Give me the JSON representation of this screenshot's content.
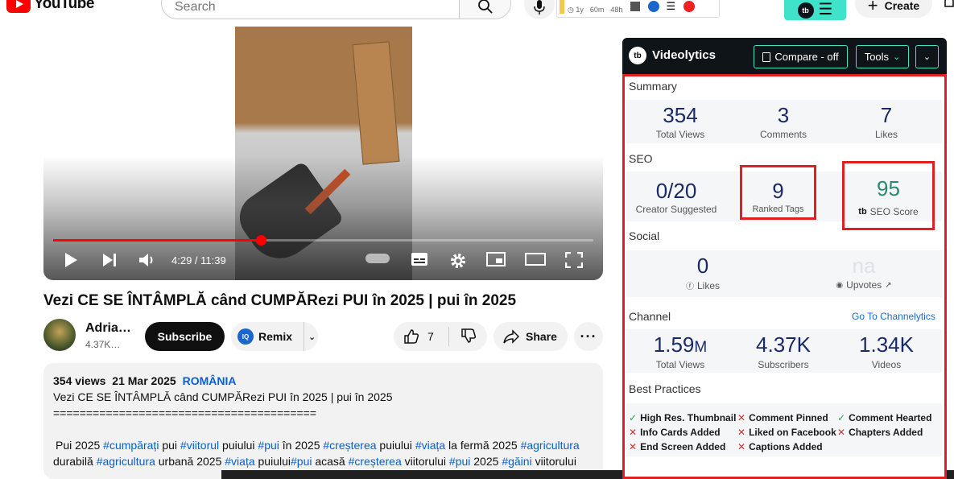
{
  "header": {
    "logo_text": "YouTube",
    "search_placeholder": "Search",
    "ext_stats": [
      "1y",
      "60m",
      "48h"
    ],
    "create_label": "Create"
  },
  "player": {
    "time": "4:29 / 11:39",
    "progress": 0.385
  },
  "video": {
    "title": "Vezi CE SE ÎNTÂMPLĂ când CUMPĂRezi PUI în 2025 | pui în 2025",
    "channel_name": "Adria…",
    "channel_subs": "4.37K…",
    "subscribe_label": "Subscribe",
    "remix_label": "Remix",
    "like_count": "7",
    "share_label": "Share"
  },
  "description": {
    "views": "354 views",
    "date": "21 Mar 2025",
    "location": "ROMÂNIA",
    "line1": "Vezi CE SE ÎNTÂMPLĂ când CUMPĂRezi PUI în 2025 | pui în 2025",
    "line2": "========================================",
    "tags_line": [
      {
        "t": "Pui 2025 ",
        "link": false
      },
      {
        "t": "#cumpărați",
        "link": true
      },
      {
        "t": " pui ",
        "link": false
      },
      {
        "t": "#viitorul",
        "link": true
      },
      {
        "t": " puiului ",
        "link": false
      },
      {
        "t": "#pui",
        "link": true
      },
      {
        "t": " în 2025 ",
        "link": false
      },
      {
        "t": "#creșterea",
        "link": true
      },
      {
        "t": " puiului ",
        "link": false
      },
      {
        "t": "#viața",
        "link": true
      },
      {
        "t": " la fermă 2025 ",
        "link": false
      },
      {
        "t": "#agricultura",
        "link": true
      }
    ],
    "tags_line2": [
      {
        "t": "durabilă ",
        "link": false
      },
      {
        "t": "#agricultura",
        "link": true
      },
      {
        "t": " urbană 2025 ",
        "link": false
      },
      {
        "t": "#viața",
        "link": true
      },
      {
        "t": " puiului",
        "link": false
      },
      {
        "t": "#pui",
        "link": true
      },
      {
        "t": " acasă ",
        "link": false
      },
      {
        "t": "#creșterea",
        "link": true
      },
      {
        "t": " viitorului ",
        "link": false
      },
      {
        "t": "#pui",
        "link": true
      },
      {
        "t": " 2025 ",
        "link": false
      },
      {
        "t": "#găini",
        "link": true
      },
      {
        "t": " viitorului",
        "link": false
      }
    ]
  },
  "videolytics": {
    "brand": "Videolytics",
    "compare_label": "Compare - off",
    "tools_label": "Tools",
    "summary_label": "Summary",
    "summary": [
      {
        "value": "354",
        "label": "Total Views"
      },
      {
        "value": "3",
        "label": "Comments"
      },
      {
        "value": "7",
        "label": "Likes"
      }
    ],
    "seo_label": "SEO",
    "seo": {
      "creator_value": "0/20",
      "creator_label": "Creator Suggested",
      "ranked_value": "9",
      "ranked_label": "Ranked Tags",
      "score_value": "95",
      "score_label": "SEO Score"
    },
    "social_label": "Social",
    "social": {
      "likes_value": "0",
      "likes_label": "Likes",
      "upvotes_value": "na",
      "upvotes_label": "Upvotes"
    },
    "channel_label": "Channel",
    "channel_link": "Go To Channelytics",
    "channel": [
      {
        "value": "1.59",
        "suffix": "M",
        "label": "Total Views"
      },
      {
        "value": "4.37K",
        "suffix": "",
        "label": "Subscribers"
      },
      {
        "value": "1.34K",
        "suffix": "",
        "label": "Videos"
      }
    ],
    "bp_label": "Best Practices",
    "best_practices": [
      {
        "label": "High Res. Thumbnail",
        "ok": true
      },
      {
        "label": "Comment Pinned",
        "ok": false
      },
      {
        "label": "Comment Hearted",
        "ok": true
      },
      {
        "label": "Info Cards Added",
        "ok": false
      },
      {
        "label": "Liked on Facebook",
        "ok": false
      },
      {
        "label": "Chapters Added",
        "ok": false
      },
      {
        "label": "End Screen Added",
        "ok": false
      },
      {
        "label": "Captions Added",
        "ok": false
      }
    ],
    "colors": {
      "accent": "#3fe3c9",
      "highlight": "#e02020",
      "stat": "#1a2a66",
      "score": "#2a8a6a"
    }
  }
}
